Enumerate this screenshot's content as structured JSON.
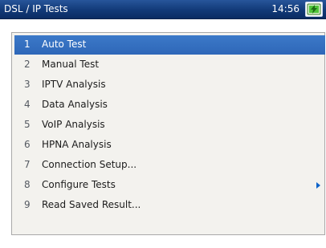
{
  "window": {
    "title": "DSL / IP Tests",
    "clock": "14:56",
    "status_icon": "battery-charging-icon",
    "accent": "#2e67b8"
  },
  "menu": {
    "selected_index": 0,
    "items": [
      {
        "number": "1",
        "label": "Auto Test"
      },
      {
        "number": "2",
        "label": "Manual Test"
      },
      {
        "number": "3",
        "label": "IPTV Analysis"
      },
      {
        "number": "4",
        "label": "Data Analysis"
      },
      {
        "number": "5",
        "label": "VoIP Analysis"
      },
      {
        "number": "6",
        "label": "HPNA Analysis"
      },
      {
        "number": "7",
        "label": "Connection Setup..."
      },
      {
        "number": "8",
        "label": "Configure Tests",
        "submenu_icon": "chevron-right-icon"
      },
      {
        "number": "9",
        "label": "Read Saved Result..."
      }
    ]
  }
}
